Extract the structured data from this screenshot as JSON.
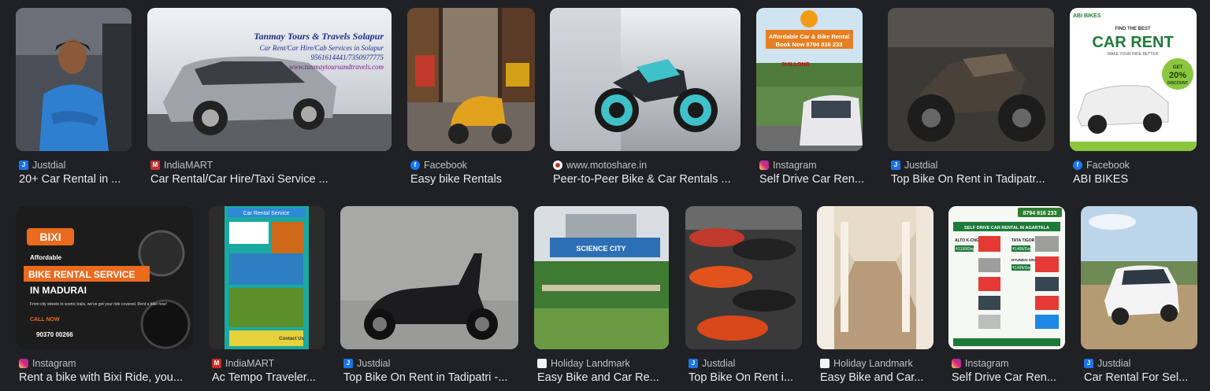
{
  "results_row1": [
    {
      "source": "Justdial",
      "source_icon": "justdial-icon",
      "title": "20+ Car Rental in ..."
    },
    {
      "source": "IndiaMART",
      "source_icon": "indiamart-icon",
      "title": "Car Rental/Car Hire/Taxi Service ...",
      "image_text": [
        "Tanmay Tours & Travels Solapur",
        "Car Rent/Car Hire/Cab Services in Solapur",
        "9561614441/7350977775",
        "www.tanmaytoursandtravels.com"
      ]
    },
    {
      "source": "Facebook",
      "source_icon": "facebook-icon",
      "title": "Easy bike Rentals"
    },
    {
      "source": "www.motoshare.in",
      "source_icon": "motoshare-icon",
      "title": "Peer-to-Peer Bike & Car Rentals ..."
    },
    {
      "source": "Instagram",
      "source_icon": "instagram-icon",
      "title": "Self Drive Car Ren...",
      "image_text": [
        "Affordable Car & Bike Rental",
        "Book Now 8794 816 233",
        "SHILLONG"
      ]
    },
    {
      "source": "Justdial",
      "source_icon": "justdial-icon",
      "title": "Top Bike On Rent in Tadipatr..."
    },
    {
      "source": "Facebook",
      "source_icon": "facebook-icon",
      "title": "ABI BIKES",
      "image_text": [
        "ABI BIKES",
        "FIND THE BEST",
        "CAR RENT",
        "MAKE YOUR RIDE BETTER",
        "GET",
        "20%",
        "DISCOUNT"
      ]
    }
  ],
  "results_row2": [
    {
      "source": "Instagram",
      "source_icon": "instagram-icon",
      "title": "Rent a bike with Bixi Ride, you...",
      "image_text": [
        "BIXI",
        "Affordable",
        "BIKE RENTAL SERVICE",
        "IN MADURAI",
        "From city streets to scenic trails, we've got your ride covered. Rent a bike now!",
        "CALL NOW",
        "90370 00266"
      ]
    },
    {
      "source": "IndiaMART",
      "source_icon": "indiamart-icon",
      "title": "Ac Tempo Traveler...",
      "image_text": [
        "Car Rental Service",
        "Contact Us"
      ]
    },
    {
      "source": "Justdial",
      "source_icon": "justdial-icon",
      "title": "Top Bike On Rent in Tadipatri -..."
    },
    {
      "source": "Holiday Landmark",
      "source_icon": "holiday-landmark-icon",
      "title": "Easy Bike and Car Re...",
      "image_text": [
        "SCIENCE CITY"
      ]
    },
    {
      "source": "Justdial",
      "source_icon": "justdial-icon",
      "title": "Top Bike On Rent i..."
    },
    {
      "source": "Holiday Landmark",
      "source_icon": "holiday-landmark-icon",
      "title": "Easy Bike and Car..."
    },
    {
      "source": "Instagram",
      "source_icon": "instagram-icon",
      "title": "Self Drive Car Ren...",
      "image_text": [
        "8794 816 233",
        "SELF DRIVE CAR RENTAL IN AGARTALA",
        "ALTO K-CNG",
        "₹1199/Day",
        "TATA TIGOR",
        "₹1499/Day",
        "HYUNDAI GRAND i10 NIOS",
        "₹1499/Day"
      ]
    },
    {
      "source": "Justdial",
      "source_icon": "justdial-icon",
      "title": "Car Rental For Sel..."
    }
  ],
  "colors": {
    "background": "#202124",
    "title_text": "#e8eaed",
    "source_text": "#bdc1c6",
    "justdial": "#1a73e8",
    "indiamart": "#c4302b",
    "facebook": "#1877f2",
    "instagram": "#d6249f"
  }
}
